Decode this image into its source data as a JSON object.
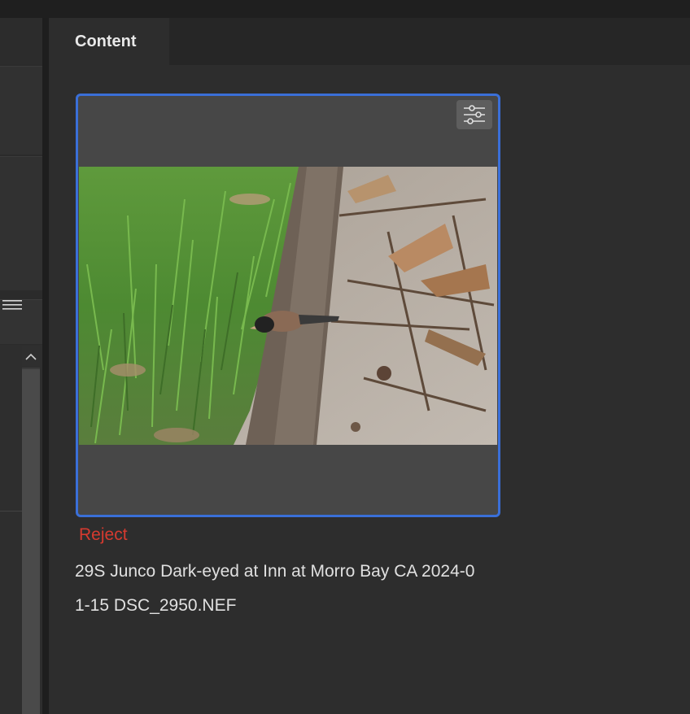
{
  "tabs": [
    {
      "label": "Content",
      "active": true
    }
  ],
  "thumbnail": {
    "selected": true,
    "rating_label": "Reject",
    "rating_color": "#d63a2f",
    "filename": "29S Junco Dark-eyed at Inn at Morro Bay CA 2024-01-15 DSC_2950.NEF",
    "filename_line1": "29S Junco Dark-eyed at Inn at Morro Bay CA 2024-0",
    "filename_line2": "1-15 DSC_2950.NEF",
    "filter_icon": "sliders-icon"
  },
  "colors": {
    "selection_border": "#3a6fd8",
    "panel_bg": "#2d2d2d",
    "card_bg": "#474747"
  }
}
